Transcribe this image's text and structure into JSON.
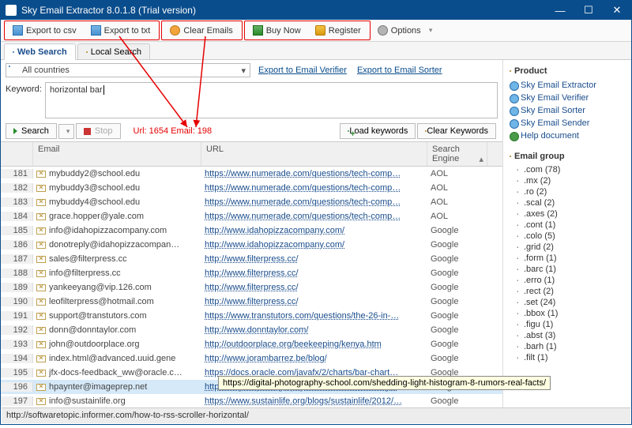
{
  "window": {
    "title": "Sky Email Extractor 8.0.1.8 (Trial version)"
  },
  "toolbar": {
    "export_csv": "Export to csv",
    "export_txt": "Export to txt",
    "clear_emails": "Clear Emails",
    "buy": "Buy Now",
    "register": "Register",
    "options": "Options"
  },
  "tabs": {
    "web": "Web Search",
    "local": "Local Search"
  },
  "filters": {
    "country": "All countries",
    "export_verifier": "Export to Email Verifier",
    "export_sorter": "Export to Email Sorter",
    "keyword_label": "Keyword:",
    "keyword_value": "horizontal bar"
  },
  "actions": {
    "search": "Search",
    "stop": "Stop",
    "stats": "Url: 1654 Email: 198",
    "load": "Load keywords",
    "clear_kw": "Clear Keywords"
  },
  "grid": {
    "headers": [
      "",
      "Email",
      "URL",
      "Search Engine"
    ],
    "rows": [
      {
        "n": 181,
        "email": "mybuddy2@school.edu",
        "url": "https://www.numerade.com/questions/tech-comp…",
        "se": "AOL"
      },
      {
        "n": 182,
        "email": "mybuddy3@school.edu",
        "url": "https://www.numerade.com/questions/tech-comp…",
        "se": "AOL"
      },
      {
        "n": 183,
        "email": "mybuddy4@school.edu",
        "url": "https://www.numerade.com/questions/tech-comp…",
        "se": "AOL"
      },
      {
        "n": 184,
        "email": "grace.hopper@yale.com",
        "url": "https://www.numerade.com/questions/tech-comp…",
        "se": "AOL"
      },
      {
        "n": 185,
        "email": "info@idahopizzacompany.com",
        "url": "http://www.idahopizzacompany.com/",
        "se": "Google"
      },
      {
        "n": 186,
        "email": "donotreply@idahopizzacompan…",
        "url": "http://www.idahopizzacompany.com/",
        "se": "Google"
      },
      {
        "n": 187,
        "email": "sales@filterpress.cc",
        "url": "http://www.filterpress.cc/",
        "se": "Google"
      },
      {
        "n": 188,
        "email": "info@filterpress.cc",
        "url": "http://www.filterpress.cc/",
        "se": "Google"
      },
      {
        "n": 189,
        "email": "yankeeyang@vip.126.com",
        "url": "http://www.filterpress.cc/",
        "se": "Google"
      },
      {
        "n": 190,
        "email": "leofilterpress@hotmail.com",
        "url": "http://www.filterpress.cc/",
        "se": "Google"
      },
      {
        "n": 191,
        "email": "support@transtutors.com",
        "url": "https://www.transtutors.com/questions/the-26-in-…",
        "se": "Google"
      },
      {
        "n": 192,
        "email": "donn@donntaylor.com",
        "url": "http://www.donntaylor.com/",
        "se": "Google"
      },
      {
        "n": 193,
        "email": "john@outdoorplace.org",
        "url": "http://outdoorplace.org/beekeeping/kenya.htm",
        "se": "Google"
      },
      {
        "n": 194,
        "email": "index.html@advanced.uuid.gene",
        "url": "http://www.jorambarrez.be/blog/",
        "se": "Google"
      },
      {
        "n": 195,
        "email": "jfx-docs-feedback_ww@oracle.c…",
        "url": "https://docs.oracle.com/javafx/2/charts/bar-chart…",
        "se": "Google"
      },
      {
        "n": 196,
        "email": "hpaynter@imageprep.net",
        "url": "https://digital-photography-school.com/shedding…",
        "se": "Google",
        "sel": true
      },
      {
        "n": 197,
        "email": "info@sustainlife.org",
        "url": "https://www.sustainlife.org/blogs/sustainlife/2012/…",
        "se": "Google"
      }
    ]
  },
  "tooltip": "https://digital-photography-school.com/shedding-light-histogram-8-rumors-real-facts/",
  "product": {
    "header": "Product",
    "items": [
      "Sky Email Extractor",
      "Sky Email Verifier",
      "Sky Email Sorter",
      "Sky Email Sender",
      "Help document"
    ]
  },
  "emailgroup": {
    "header": "Email group",
    "items": [
      ".com (78)",
      ".mx (2)",
      ".ro (2)",
      ".scal (2)",
      ".axes (2)",
      ".cont (1)",
      ".colo (5)",
      ".grid (2)",
      ".form (1)",
      ".barc (1)",
      ".erro (1)",
      ".rect (2)",
      ".set (24)",
      ".bbox (1)",
      ".figu (1)",
      ".abst (3)",
      ".barh (1)",
      ".filt (1)"
    ]
  },
  "statusbar": "http://softwaretopic.informer.com/how-to-rss-scroller-horizontal/"
}
